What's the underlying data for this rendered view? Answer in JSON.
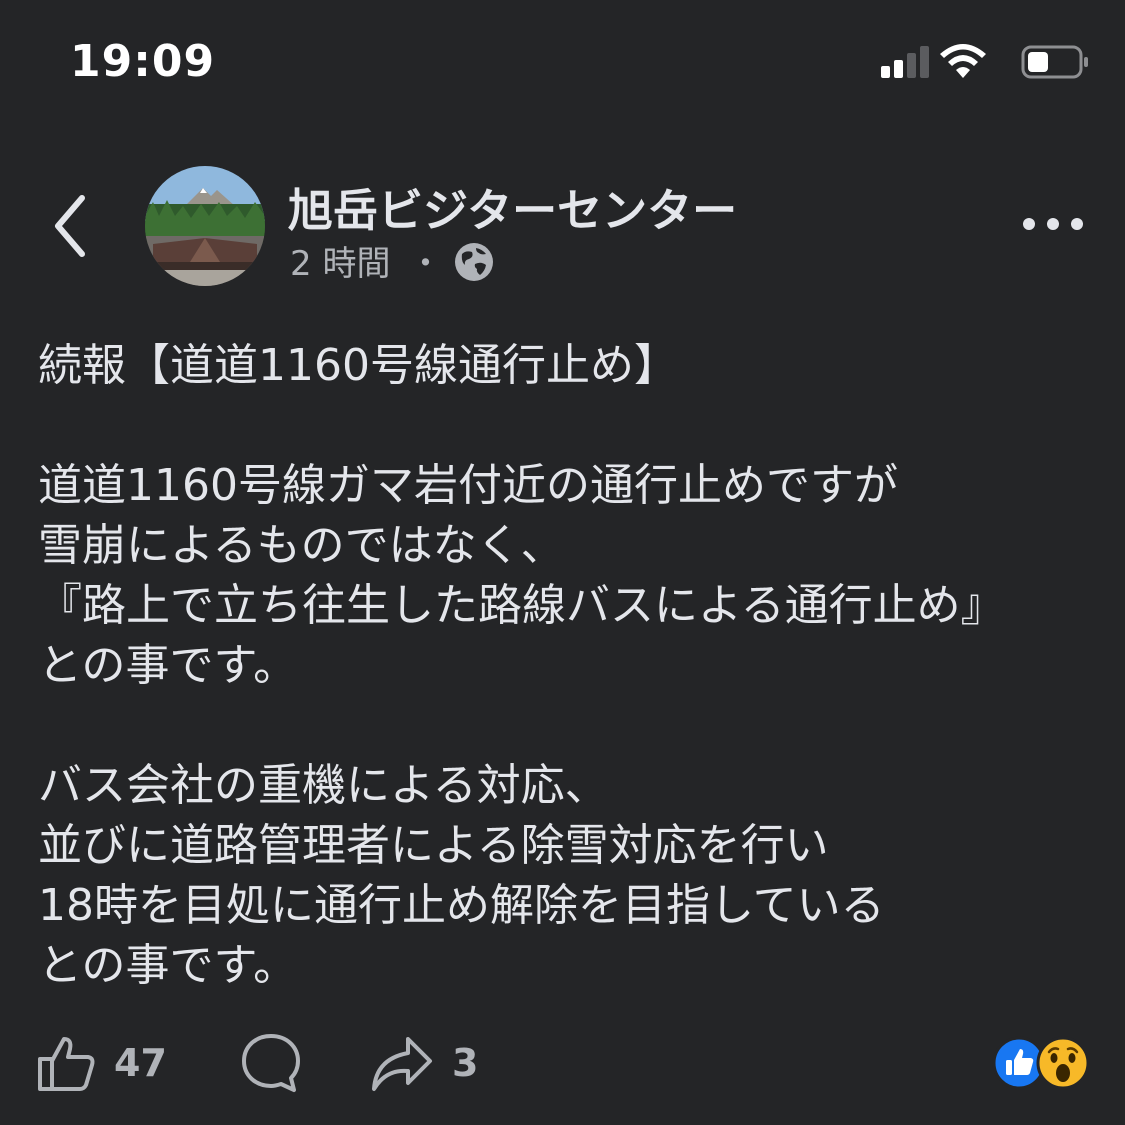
{
  "status_bar": {
    "time": "19:09",
    "icons": [
      "cellular-signal-icon",
      "wifi-icon",
      "battery-icon"
    ]
  },
  "post": {
    "page_name": "旭岳ビジターセンター",
    "time_ago": "2 時間",
    "separator": "・",
    "audience_icon": "globe-icon",
    "body": "続報【道道1160号線通行止め】\n\n道道1160号線ガマ岩付近の通行止めですが\n雪崩によるものではなく、\n『路上で立ち往生した路線バスによる通行止め』\nとの事です。\n\nバス会社の重機による対応、\n並びに道路管理者による除雪対応を行い\n18時を目処に通行止め解除を目指している\nとの事です。"
  },
  "actions": {
    "like_count": "47",
    "share_count": "3",
    "reactions": [
      "like-reaction-icon",
      "wow-reaction-icon"
    ]
  },
  "colors": {
    "background": "#242527",
    "primary_text": "#e4e6eb",
    "secondary_text": "#b0b3b8",
    "like_blue": "#1877f2",
    "wow_yellow": "#f7b928"
  }
}
